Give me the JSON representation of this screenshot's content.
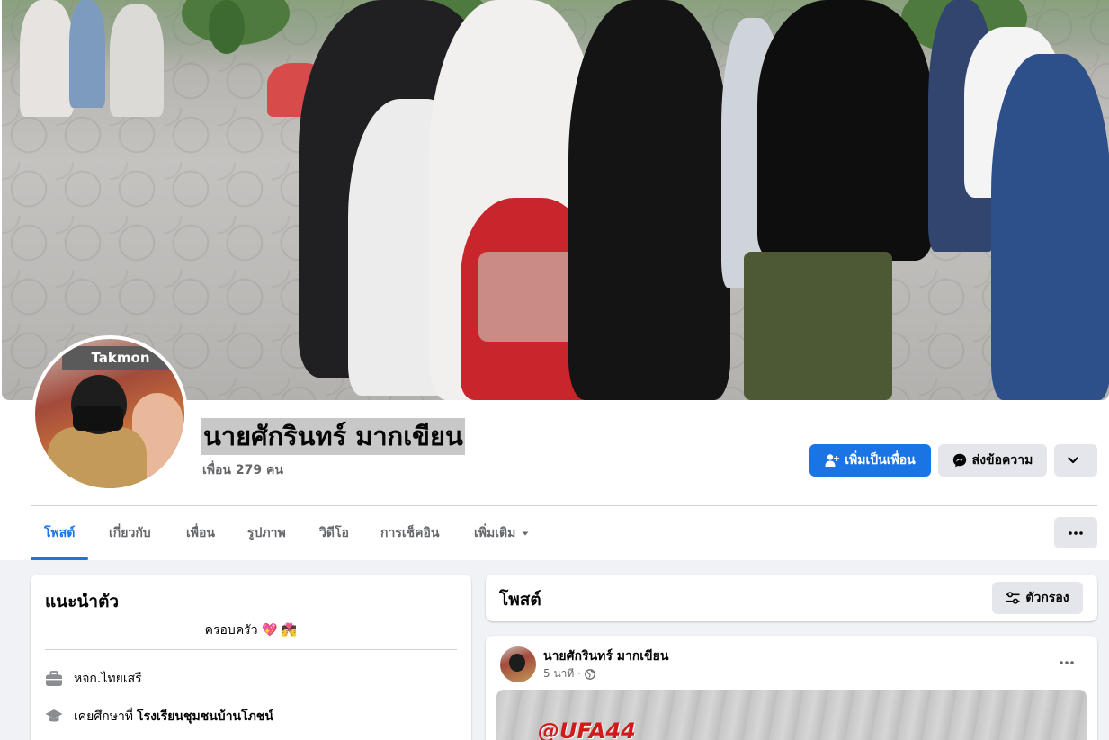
{
  "profile": {
    "name": "นายศักรินทร์ มากเขียน",
    "friends": "เพื่อน 279 คน"
  },
  "actions": {
    "add_friend": "เพิ่มเป็นเพื่อน",
    "message": "ส่งข้อความ"
  },
  "tabs": [
    {
      "label": "โพสต์",
      "active": true
    },
    {
      "label": "เกี่ยวกับ"
    },
    {
      "label": "เพื่อน"
    },
    {
      "label": "รูปภาพ"
    },
    {
      "label": "วิดีโอ"
    },
    {
      "label": "การเช็คอิน"
    },
    {
      "label": "เพิ่มเติม"
    }
  ],
  "intro": {
    "title": "แนะนำตัว",
    "bio": "ครอบครัว 💖 💏",
    "work": "หจก.ไทยเสรี",
    "education_prefix": "เคยศึกษาที่",
    "education_school": "โรงเรียนชุมชนบ้านโภชน์"
  },
  "posts": {
    "title": "โพสต์",
    "filter_label": "ตัวกรอง",
    "items": [
      {
        "author": "นายศักรินทร์ มากเขียน",
        "time": "5 นาที ·",
        "image_text": "@UFA44"
      }
    ]
  },
  "avatar_sign_text": "Takmon",
  "colors": {
    "primary": "#1b74e4",
    "secondary_bg": "#e4e6eb",
    "page_bg": "#f0f2f5"
  }
}
